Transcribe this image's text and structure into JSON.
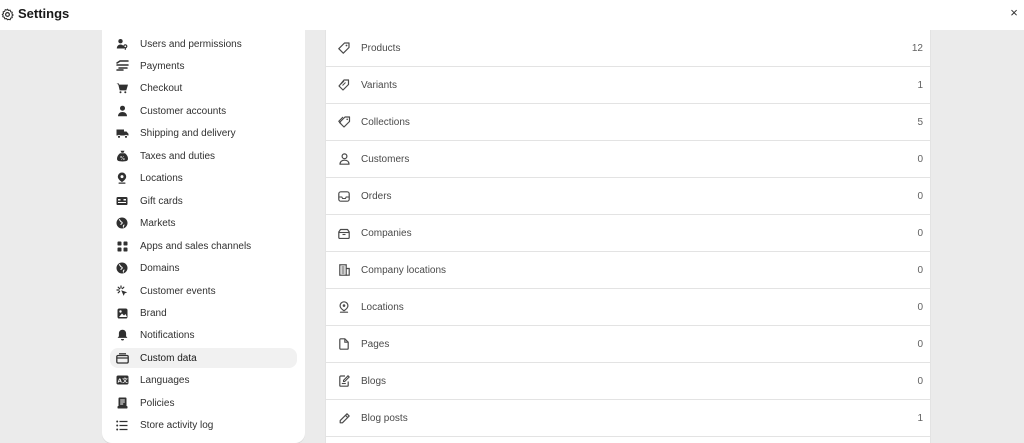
{
  "header": {
    "title": "Settings",
    "close_glyph": "×"
  },
  "sidebar": {
    "items": [
      {
        "label": "Users and permissions",
        "icon": "users-icon"
      },
      {
        "label": "Payments",
        "icon": "payments-icon"
      },
      {
        "label": "Checkout",
        "icon": "cart-icon"
      },
      {
        "label": "Customer accounts",
        "icon": "person-icon"
      },
      {
        "label": "Shipping and delivery",
        "icon": "truck-icon"
      },
      {
        "label": "Taxes and duties",
        "icon": "tax-bag-icon"
      },
      {
        "label": "Locations",
        "icon": "location-pin-icon"
      },
      {
        "label": "Gift cards",
        "icon": "gift-card-icon"
      },
      {
        "label": "Markets",
        "icon": "globe-icon"
      },
      {
        "label": "Apps and sales channels",
        "icon": "apps-icon"
      },
      {
        "label": "Domains",
        "icon": "globe-icon"
      },
      {
        "label": "Customer events",
        "icon": "cursor-click-icon"
      },
      {
        "label": "Brand",
        "icon": "brand-icon"
      },
      {
        "label": "Notifications",
        "icon": "bell-icon"
      },
      {
        "label": "Custom data",
        "icon": "custom-data-icon",
        "active": true
      },
      {
        "label": "Languages",
        "icon": "language-icon"
      },
      {
        "label": "Policies",
        "icon": "policies-icon"
      },
      {
        "label": "Store activity log",
        "icon": "list-icon"
      }
    ]
  },
  "main": {
    "rows": [
      {
        "label": "Products",
        "count": "12",
        "icon": "tag-icon"
      },
      {
        "label": "Variants",
        "count": "1",
        "icon": "variants-icon"
      },
      {
        "label": "Collections",
        "count": "5",
        "icon": "collections-icon"
      },
      {
        "label": "Customers",
        "count": "0",
        "icon": "person-outline-icon"
      },
      {
        "label": "Orders",
        "count": "0",
        "icon": "inbox-icon"
      },
      {
        "label": "Companies",
        "count": "0",
        "icon": "companies-icon"
      },
      {
        "label": "Company locations",
        "count": "0",
        "icon": "building-icon"
      },
      {
        "label": "Locations",
        "count": "0",
        "icon": "location-outline-icon"
      },
      {
        "label": "Pages",
        "count": "0",
        "icon": "page-icon"
      },
      {
        "label": "Blogs",
        "count": "0",
        "icon": "blog-icon"
      },
      {
        "label": "Blog posts",
        "count": "1",
        "icon": "pencil-icon"
      }
    ]
  }
}
